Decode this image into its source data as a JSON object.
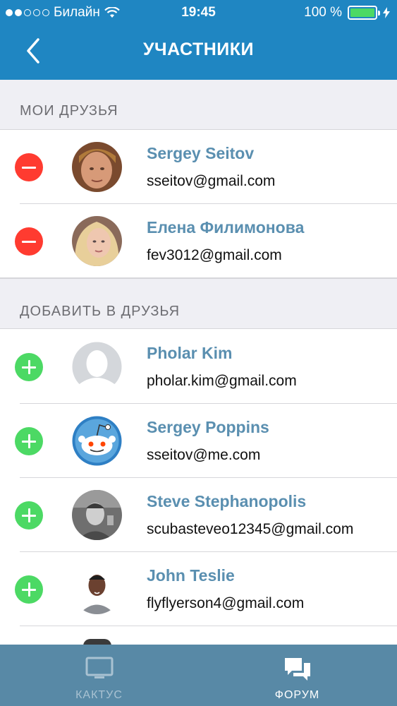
{
  "status_bar": {
    "carrier": "Билайн",
    "time": "19:45",
    "battery": "100 %"
  },
  "nav": {
    "title": "УЧАСТНИКИ"
  },
  "sections": [
    {
      "title": "МОИ ДРУЗЬЯ",
      "items": [
        {
          "name": "Sergey Seitov",
          "email": "sseitov@gmail.com",
          "action": "remove"
        },
        {
          "name": "Елена Филимонова",
          "email": "fev3012@gmail.com",
          "action": "remove"
        }
      ]
    },
    {
      "title": "ДОБАВИТЬ В ДРУЗЬЯ",
      "items": [
        {
          "name": "Pholar Kim",
          "email": "pholar.kim@gmail.com",
          "action": "add"
        },
        {
          "name": "Sergey Poppins",
          "email": "sseitov@me.com",
          "action": "add"
        },
        {
          "name": "Steve Stephanopolis",
          "email": "scubasteveo12345@gmail.com",
          "action": "add"
        },
        {
          "name": "John Teslie",
          "email": "flyflyerson4@gmail.com",
          "action": "add"
        }
      ]
    }
  ],
  "tab_bar": {
    "tabs": [
      {
        "label": "КАКТУС",
        "icon": "tv-icon",
        "active": false
      },
      {
        "label": "ФОРУМ",
        "icon": "chat-bubbles-icon",
        "active": true
      }
    ]
  },
  "colors": {
    "nav_bg": "#1f86c2",
    "remove": "#ff3b30",
    "add": "#4cd964",
    "name": "#5a8fb0",
    "tabbar_bg": "#5889a6"
  }
}
